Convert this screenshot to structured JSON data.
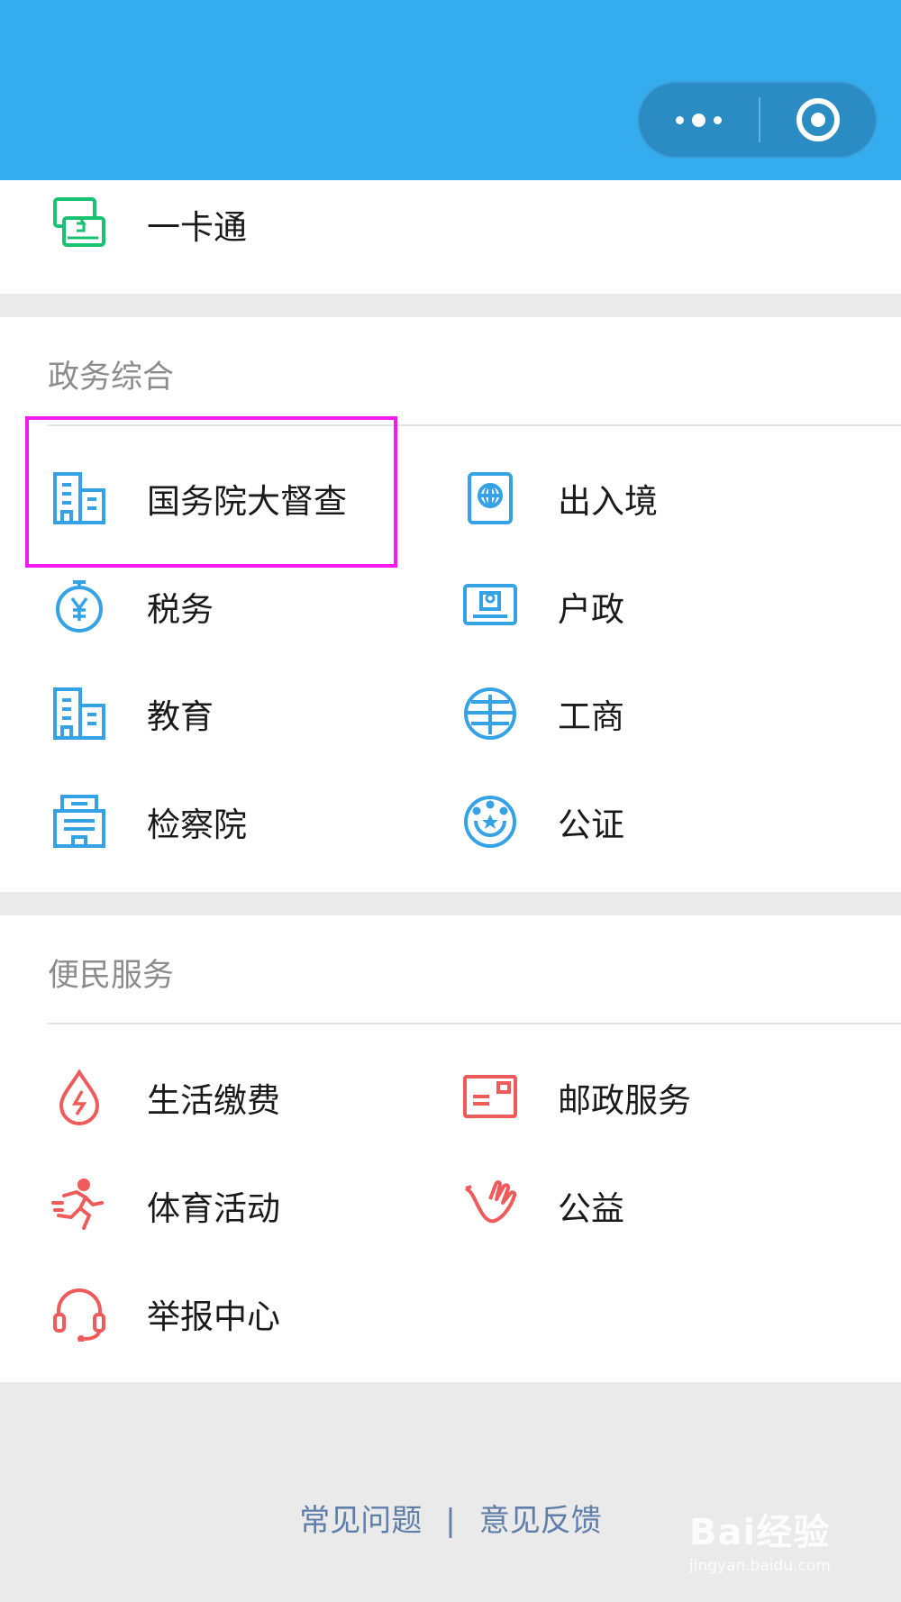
{
  "colors": {
    "header": "#35acee",
    "gov_icon": "#35a2e6",
    "life_icon": "#ef5a5a",
    "card_icon": "#19c270",
    "highlight": "#f21cf0"
  },
  "top_item": {
    "label": "一卡通",
    "icon": "card-exchange-icon"
  },
  "gov_section": {
    "title": "政务综合",
    "items": [
      {
        "label": "国务院大督查",
        "icon": "building-icon"
      },
      {
        "label": "出入境",
        "icon": "passport-icon"
      },
      {
        "label": "税务",
        "icon": "tax-yen-icon"
      },
      {
        "label": "户政",
        "icon": "id-card-icon"
      },
      {
        "label": "教育",
        "icon": "building-icon"
      },
      {
        "label": "工商",
        "icon": "commerce-icon"
      },
      {
        "label": "检察院",
        "icon": "procuratorate-icon"
      },
      {
        "label": "公证",
        "icon": "notary-seal-icon"
      }
    ]
  },
  "life_section": {
    "title": "便民服务",
    "items": [
      {
        "label": "生活缴费",
        "icon": "utility-drop-icon"
      },
      {
        "label": "邮政服务",
        "icon": "postal-envelope-icon"
      },
      {
        "label": "体育活动",
        "icon": "running-icon"
      },
      {
        "label": "公益",
        "icon": "charity-hand-icon"
      },
      {
        "label": "举报中心",
        "icon": "headset-icon"
      }
    ]
  },
  "footer": {
    "faq": "常见问题",
    "separator": "|",
    "feedback": "意见反馈"
  },
  "watermark": {
    "main": "Bai经验",
    "sub": "jingyan.baidu.com"
  }
}
